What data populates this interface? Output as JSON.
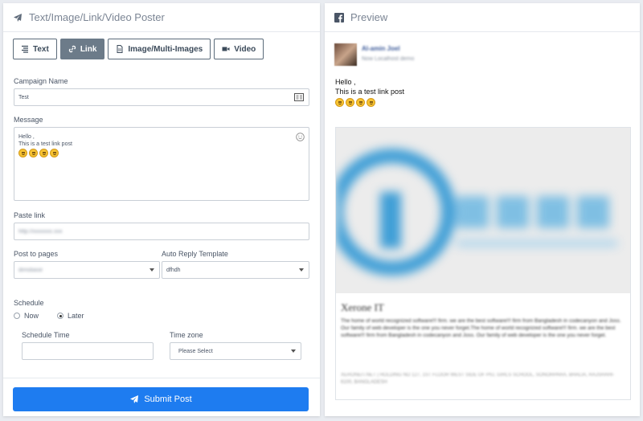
{
  "poster": {
    "title": "Text/Image/Link/Video Poster",
    "tabs": [
      {
        "label": "Text",
        "icon": "text-align-icon"
      },
      {
        "label": "Link",
        "icon": "link-icon",
        "active": true
      },
      {
        "label": "Image/Multi-Images",
        "icon": "file-image-icon"
      },
      {
        "label": "Video",
        "icon": "video-camera-icon"
      }
    ],
    "campaign_label": "Campaign Name",
    "campaign_value": "Test",
    "message_label": "Message",
    "message_lines": [
      "Hello ,",
      "This is a test link post"
    ],
    "paste_link_label": "Paste link",
    "paste_link_value": "http://xxxxxxx.xxx",
    "post_to_pages_label": "Post to pages",
    "post_to_pages_value": "dimsbase",
    "auto_reply_label": "Auto Reply Template",
    "auto_reply_value": "dfhdh",
    "schedule_label": "Schedule",
    "schedule_now": "Now",
    "schedule_later": "Later",
    "schedule_time_label": "Schedule Time",
    "timezone_label": "Time zone",
    "timezone_value": "Please Select",
    "submit_label": "Submit Post"
  },
  "preview": {
    "title": "Preview",
    "user_name": "Al-amin Joel",
    "user_meta": "Now Localhost demo",
    "post_lines": [
      "Hello ,",
      "This is a test link post"
    ],
    "link_title": "Xerone IT",
    "link_desc": "The home of world recognized software!!! firm. we are the best software!!! firm from Bangladesh in codecanyon and Joss. Our family of web developer is the one you never forget.The home of world recognized software!!! firm. we are the best software!!! firm from Bangladesh in codecanyon and Joss. Our family of web developer is the one you never forget.",
    "link_domain": "XERONEIT.NET | HOLDING NO 127, 1ST FLOOR WEST SIDE OF PIU, GIRLS SCHOOL, SONORPARA, BHALIA, RAJSHAHI-6100, BANGLADESH"
  },
  "colors": {
    "accent": "#1e7cf0",
    "tab_active": "#6c7b89",
    "facebook": "#3b5998"
  }
}
